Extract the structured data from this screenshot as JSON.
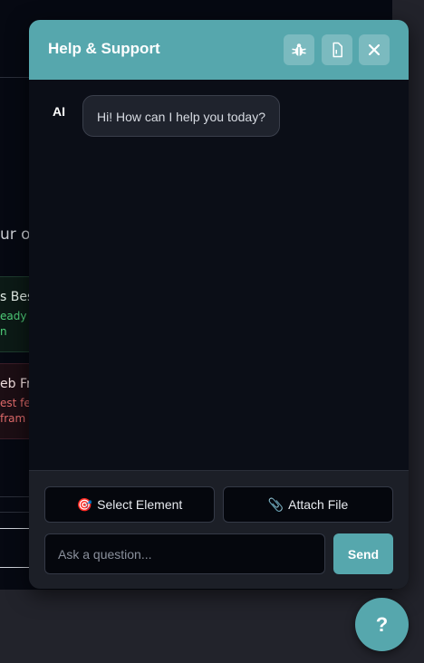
{
  "background_page": {
    "fragment_1": "ur ow",
    "card_green": {
      "title": "s Bes",
      "line1": "eady p",
      "line2": "n"
    },
    "card_red": {
      "title": "eb Fr",
      "line1": "est fea",
      "line2": " fram"
    }
  },
  "panel": {
    "title": "Help & Support",
    "header_icons": [
      "bug-icon",
      "document-icon",
      "close-icon"
    ],
    "messages": [
      {
        "sender": "AI",
        "text": "Hi! How can I help you today?"
      }
    ],
    "tools": {
      "select_element": {
        "icon": "🎯",
        "label": "Select Element"
      },
      "attach_file": {
        "icon": "📎",
        "label": "Attach File"
      }
    },
    "input": {
      "placeholder": "Ask a question...",
      "value": ""
    },
    "send_label": "Send"
  },
  "help_button": {
    "label": "?"
  },
  "colors": {
    "accent": "#56a7ad",
    "panel_bg": "#0b0e17",
    "footer_bg": "#1c1f27",
    "bubble_bg": "#1f232d"
  }
}
